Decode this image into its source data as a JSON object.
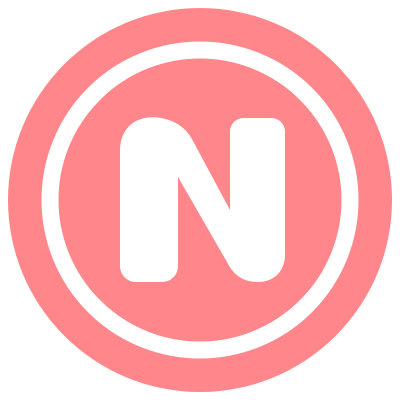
{
  "logo": {
    "icon": "n-monogram-icon",
    "letter": "N",
    "colors": {
      "background": "#ff878b",
      "foreground": "#ffffff"
    }
  }
}
